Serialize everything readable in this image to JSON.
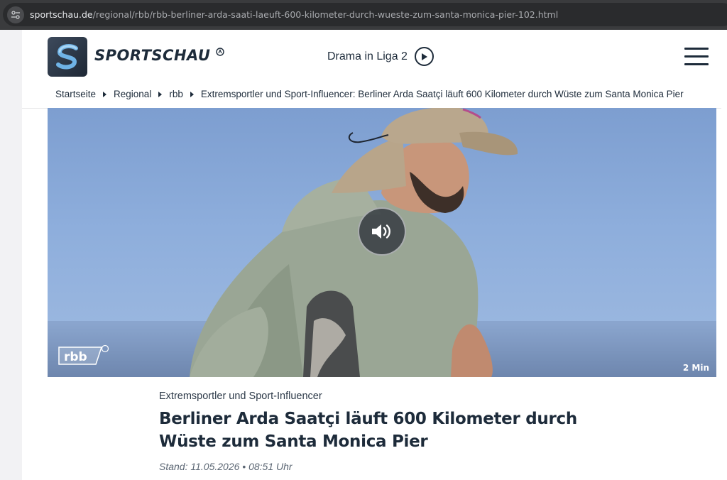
{
  "browser": {
    "url_domain": "sportschau.de",
    "url_path": "/regional/rbb/rbb-berliner-arda-saati-laeuft-600-kilometer-durch-wueste-zum-santa-monica-pier-102.html"
  },
  "header": {
    "logo_text": "SPORTSCHAU",
    "promo_label": "Drama in Liga 2",
    "brand_color": "#1d2b3a"
  },
  "breadcrumb": [
    "Startseite",
    "Regional",
    "rbb",
    "Extremsportler und Sport-Influencer: Berliner Arda Saatçi läuft 600 Kilometer durch Wüste zum Santa Monica Pier"
  ],
  "video": {
    "broadcaster_logo": "rbb",
    "duration": "2 Min",
    "sound_icon": "speaker-icon"
  },
  "article": {
    "kicker": "Extremsportler und Sport-Influencer",
    "headline": "Berliner Arda Saatçi läuft 600 Kilometer durch Wüste zum Santa Monica Pier",
    "stand": "Stand: 11.05.2026 • 08:51 Uhr"
  }
}
